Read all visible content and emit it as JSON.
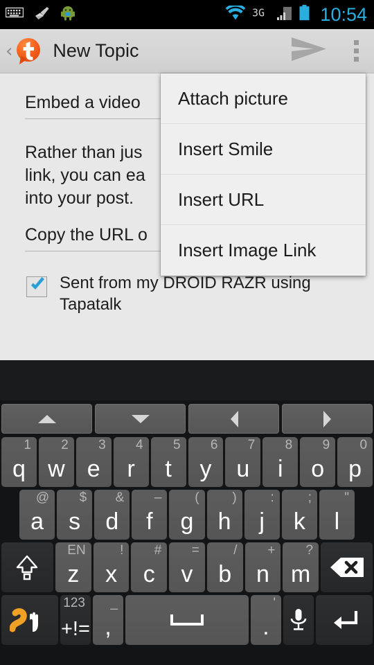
{
  "statusbar": {
    "icons": [
      "keyboard-icon",
      "broom-icon",
      "android-robot-icon",
      "wifi-icon",
      "network-3g-icon",
      "signal-bars-icon",
      "battery-icon"
    ],
    "network_label": "3G",
    "time": "10:54"
  },
  "actionbar": {
    "back_label": "‹",
    "app_icon": "tapatalk-logo-icon",
    "title": "New Topic",
    "send_icon": "send-icon",
    "overflow_icon": "overflow-menu-icon"
  },
  "compose": {
    "subject_value": "Embed a video ",
    "body_value": "Rather than jus\nlink, you can ea\ninto your post.",
    "url_field_value": "Copy the URL o",
    "signature_checked": true,
    "signature_label": "Sent from my DROID RAZR using Tapatalk"
  },
  "menu": {
    "items": [
      {
        "label": "Attach picture"
      },
      {
        "label": "Insert Smile"
      },
      {
        "label": "Insert URL"
      },
      {
        "label": "Insert Image Link"
      }
    ]
  },
  "keyboard": {
    "nav_row": [
      {
        "name": "arrow-up-icon"
      },
      {
        "name": "arrow-down-icon"
      },
      {
        "name": "arrow-left-icon"
      },
      {
        "name": "arrow-right-icon"
      }
    ],
    "row1": [
      {
        "key": "q",
        "alt": "1"
      },
      {
        "key": "w",
        "alt": "2"
      },
      {
        "key": "e",
        "alt": "3"
      },
      {
        "key": "r",
        "alt": "4"
      },
      {
        "key": "t",
        "alt": "5"
      },
      {
        "key": "y",
        "alt": "6"
      },
      {
        "key": "u",
        "alt": "7"
      },
      {
        "key": "i",
        "alt": "8"
      },
      {
        "key": "o",
        "alt": "9"
      },
      {
        "key": "p",
        "alt": "0"
      }
    ],
    "row2": [
      {
        "key": "a",
        "alt": "@"
      },
      {
        "key": "s",
        "alt": "$"
      },
      {
        "key": "d",
        "alt": "&"
      },
      {
        "key": "f",
        "alt": "–"
      },
      {
        "key": "g",
        "alt": "("
      },
      {
        "key": "h",
        "alt": ")"
      },
      {
        "key": "j",
        "alt": ":"
      },
      {
        "key": "k",
        "alt": ";"
      },
      {
        "key": "l",
        "alt": "\""
      }
    ],
    "row3": [
      {
        "key": "z",
        "alt": "EN"
      },
      {
        "key": "x",
        "alt": "!"
      },
      {
        "key": "c",
        "alt": "#"
      },
      {
        "key": "v",
        "alt": "="
      },
      {
        "key": "b",
        "alt": "/"
      },
      {
        "key": "n",
        "alt": "+"
      },
      {
        "key": "m",
        "alt": "?"
      }
    ],
    "shift_label": "shift-key-icon",
    "backspace_label": "backspace-key-icon",
    "swype_label": "swype-gesture-icon",
    "symbols_top": "123",
    "symbols_main": "+!=",
    "comma_alt": "_",
    "comma_main": ",",
    "space_label": "space-key",
    "period_alt": "'",
    "period_main": ".",
    "mic_label": "microphone-key-icon",
    "enter_label": "enter-key-icon"
  },
  "colors": {
    "accent_blue": "#2aaee0",
    "tapatalk_orange": "#f26522",
    "keyboard_bg": "#131415",
    "key_face": "#5d5d5d",
    "content_bg": "#e8e8e8",
    "menu_bg": "#efefef"
  }
}
